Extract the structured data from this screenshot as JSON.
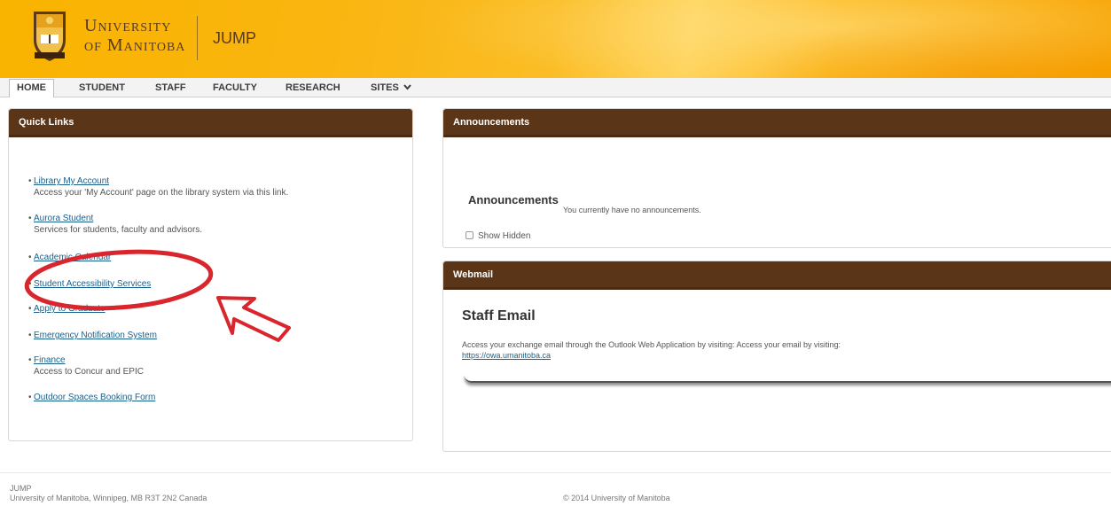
{
  "header": {
    "university_line1": "University",
    "university_line2": "of Manitoba",
    "site_name": "JUMP",
    "colors": {
      "bar": "#f9b400",
      "brand_brown": "#5b3a1c"
    }
  },
  "nav": {
    "items": [
      {
        "label": "HOME",
        "active": true
      },
      {
        "label": "STUDENT"
      },
      {
        "label": "STAFF"
      },
      {
        "label": "FACULTY"
      },
      {
        "label": "RESEARCH"
      },
      {
        "label": "SITES"
      }
    ],
    "sites_icon": "chevron-down-icon"
  },
  "quick_links": {
    "title": "Quick Links",
    "items": [
      {
        "label": "Library My Account",
        "desc": "Access your 'My Account' page on the library system via this link."
      },
      {
        "label": "Aurora Student",
        "desc": "Services for students, faculty and advisors."
      },
      {
        "label": "Academic Calendar"
      },
      {
        "label": "Student Accessibility Services"
      },
      {
        "label": "Apply to Graduate"
      },
      {
        "label": "Emergency Notification System"
      },
      {
        "label": "Finance",
        "desc": "Access to Concur and EPIC"
      },
      {
        "label": "Outdoor Spaces Booking Form"
      }
    ]
  },
  "announcements": {
    "panel_title": "Announcements",
    "heading": "Announcements",
    "message": "You currently have no announcements.",
    "show_hidden": "Show Hidden"
  },
  "webmail": {
    "panel_title": "Webmail",
    "heading": "Staff Email",
    "text": "Access your exchange email through the Outlook Web Application by visiting: Access your email by visiting:",
    "link": "https://owa.umanitoba.ca"
  },
  "footer": {
    "line1": "JUMP",
    "address": "University of Manitoba, Winnipeg, MB R3T 2N2 Canada",
    "copyright": "© 2014 University of Manitoba"
  },
  "annotation_colors": {
    "circle": "#d9252c",
    "arrow": "#d9252c"
  }
}
